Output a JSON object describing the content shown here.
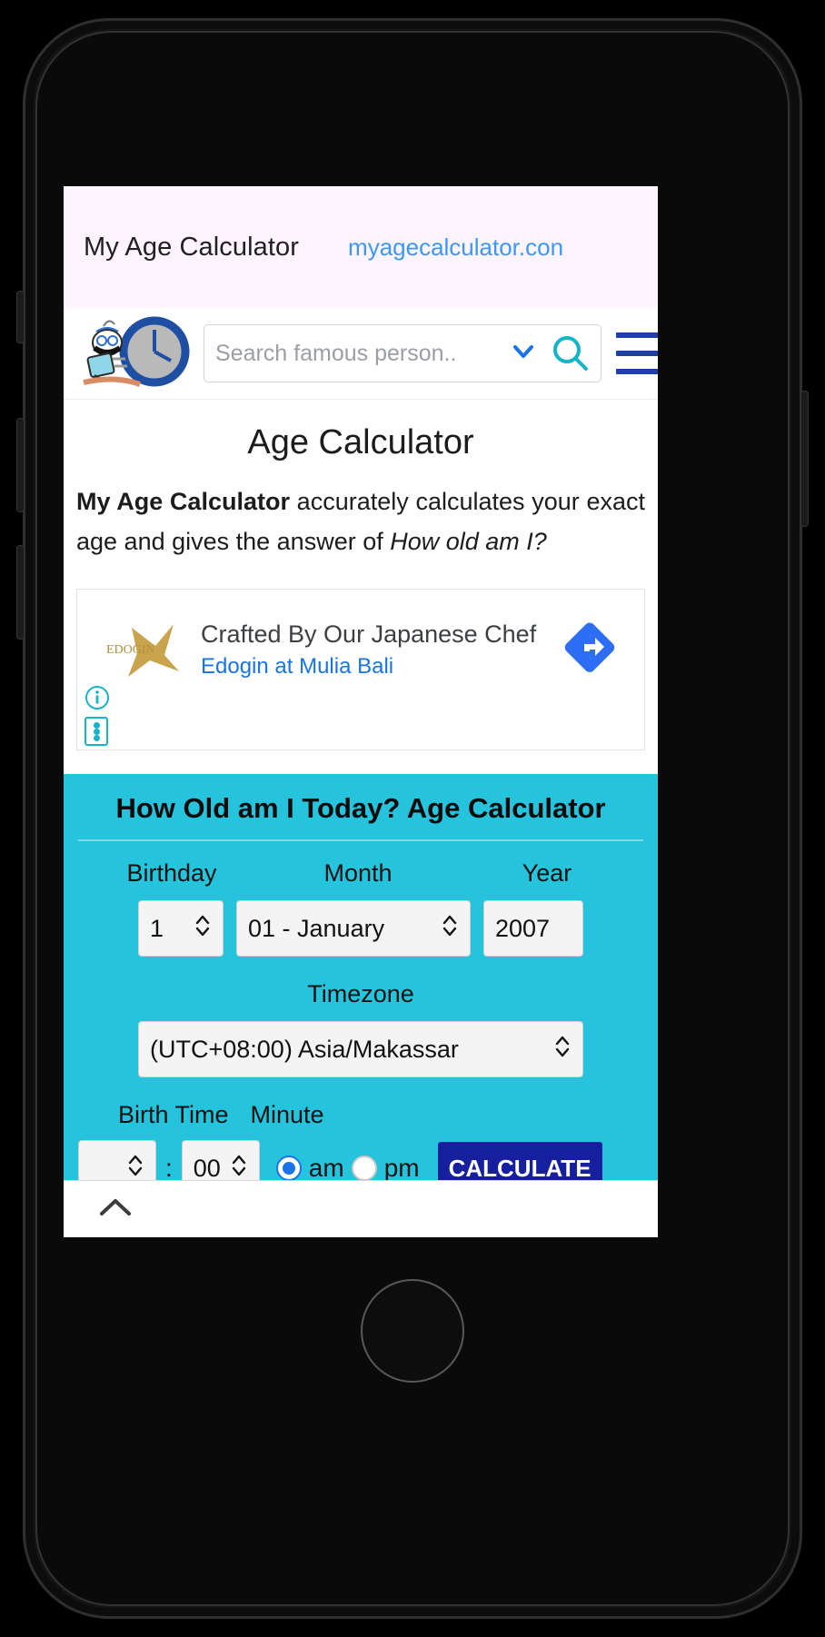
{
  "header": {
    "brand": "My Age Calculator",
    "url": "myagecalculator.con"
  },
  "nav": {
    "logo_name": "clock-character-logo",
    "search_placeholder": "Search famous person..",
    "search_value": "",
    "dropdown_icon": "chevron-down-icon",
    "search_icon": "search-icon",
    "menu_icon": "hamburger-menu-icon"
  },
  "page": {
    "title": "Age Calculator",
    "description_bold": "My Age Calculator",
    "description_mid": " accurately calculates your exact age and gives the answer of ",
    "description_italic": "How old am I?"
  },
  "ad": {
    "logo_text": "EDOGIN",
    "headline": "Crafted By Our Japanese Chef",
    "link": "Edogin at Mulia Bali",
    "cta_icon": "directions-arrow-icon",
    "adchoices_icon": "info-icon",
    "options_icon": "more-options-icon"
  },
  "calculator": {
    "heading": "How Old am I Today? Age Calculator",
    "labels": {
      "day": "Birthday",
      "month": "Month",
      "year": "Year",
      "timezone": "Timezone",
      "birth_time": "Birth Time",
      "minute": "Minute"
    },
    "values": {
      "day": "1",
      "month": "01 - January",
      "year": "2007",
      "timezone": "(UTC+08:00) Asia/Makassar",
      "hour": "",
      "minute": "00",
      "colon": ":",
      "am_label": "am",
      "pm_label": "pm",
      "meridiem_selected": "am"
    },
    "submit_label": "CALCULATE",
    "panel_color": "#25c4dc",
    "button_color": "#16209e"
  },
  "browser": {
    "scroll_up_icon": "chevron-up-icon"
  }
}
